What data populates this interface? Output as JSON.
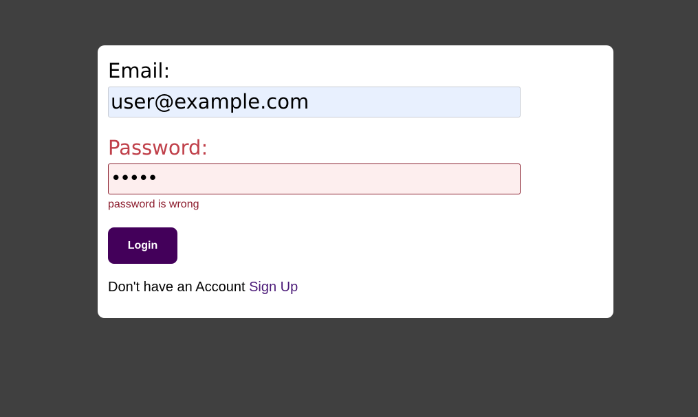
{
  "form": {
    "email_label": "Email:",
    "email_value": "user@example.com",
    "password_label": "Password:",
    "password_value": "•••••",
    "password_error": "password is wrong",
    "login_label": "Login",
    "signup_prompt": "Don't have an Account",
    "signup_link": "Sign Up"
  },
  "colors": {
    "background": "#404040",
    "card": "#ffffff",
    "accent": "#43005a",
    "error": "#c0404a",
    "email_field_bg": "#e8f0fe",
    "password_field_bg": "#fdeeee",
    "link": "#4b1a78"
  }
}
